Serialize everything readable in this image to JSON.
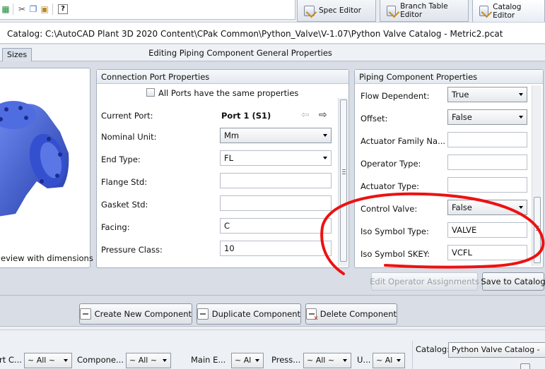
{
  "toolbar": {
    "icons": [
      "excel-export-icon",
      "cut-icon",
      "copy-icon",
      "paste-icon",
      "help-icon"
    ],
    "help_glyph": "?"
  },
  "tabs": [
    {
      "label": "Spec Editor",
      "icon": "spec-editor-icon",
      "active": false
    },
    {
      "label": "Branch Table Editor",
      "icon": "branch-table-icon",
      "active": false
    },
    {
      "label": "Catalog Editor",
      "icon": "catalog-editor-icon",
      "active": true
    }
  ],
  "catalog_path": "Catalog: C:\\AutoCAD Plant 3D 2020 Content\\CPak Common\\Python_Valve\\V-1.07\\Python Valve Catalog - Metric2.pcat",
  "sizes_tab": "Sizes",
  "editing_title": "Editing Piping Component General Properties",
  "preview": {
    "caption": "eview with dimensions",
    "body_color": "#3b58d6"
  },
  "connection": {
    "header": "Connection Port Properties",
    "all_ports_label": "All Ports have the same properties",
    "all_ports_checked": false,
    "current_port_label": "Current Port:",
    "current_port_value": "Port 1 (S1)",
    "rows": [
      {
        "label": "Nominal Unit:",
        "value": "Mm",
        "type": "dropdown"
      },
      {
        "label": "End Type:",
        "value": "FL",
        "type": "dropdown-flat"
      },
      {
        "label": "Flange Std:",
        "value": "",
        "type": "text"
      },
      {
        "label": "Gasket Std:",
        "value": "",
        "type": "text"
      },
      {
        "label": "Facing:",
        "value": "C",
        "type": "text"
      },
      {
        "label": "Pressure Class:",
        "value": "10",
        "type": "text"
      }
    ]
  },
  "piping": {
    "header": "Piping Component Properties",
    "rows": [
      {
        "label": "Flow Dependent:",
        "value": "True",
        "type": "dropdown"
      },
      {
        "label": "Offset:",
        "value": "False",
        "type": "dropdown"
      },
      {
        "label": "Actuator Family Na...",
        "value": "",
        "type": "text"
      },
      {
        "label": "Operator Type:",
        "value": "",
        "type": "text"
      },
      {
        "label": "Actuator Type:",
        "value": "",
        "type": "text"
      },
      {
        "label": "Control Valve:",
        "value": "False",
        "type": "dropdown"
      },
      {
        "label": "Iso Symbol Type:",
        "value": "VALVE",
        "type": "text"
      },
      {
        "label": "Iso Symbol SKEY:",
        "value": "VCFL",
        "type": "text"
      }
    ],
    "annotation_color": "#ee1111"
  },
  "buttons": {
    "edit_operator": "Edit Operator Assignments",
    "save_catalog": "Save to Catalog",
    "create": "Create New Component",
    "duplicate": "Duplicate Component",
    "delete": "Delete Component"
  },
  "filters": [
    {
      "label": "rt C...",
      "value": "~ All ~"
    },
    {
      "label": "Compone...",
      "value": "~ All ~"
    },
    {
      "label": "Main E...",
      "value": "~ Al"
    },
    {
      "label": "Press...",
      "value": "~ All ~"
    },
    {
      "label": "U...",
      "value": "~ Al"
    }
  ],
  "catalog_filter": {
    "label": "Catalog:",
    "value": "Python Valve Catalog -"
  }
}
